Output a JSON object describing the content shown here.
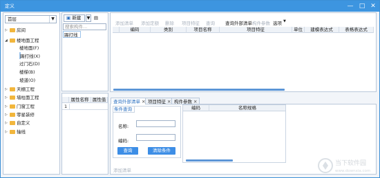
{
  "window": {
    "title": "定义"
  },
  "left": {
    "floor_select": "首层",
    "tree": [
      {
        "label": "房间",
        "level": 0,
        "expanded": false
      },
      {
        "label": "楼地面工程",
        "level": 0,
        "expanded": true
      },
      {
        "label": "楼地面(F)",
        "level": 1
      },
      {
        "label": "踢打线(X)",
        "level": 1,
        "selected": true
      },
      {
        "label": "过门石(D)",
        "level": 1
      },
      {
        "label": "楼梯(B)",
        "level": 1
      },
      {
        "label": "坡道(O)",
        "level": 1
      },
      {
        "label": "天棚工程",
        "level": 0,
        "expanded": false
      },
      {
        "label": "墙柱面工程",
        "level": 0,
        "expanded": false
      },
      {
        "label": "门窗工程",
        "level": 0,
        "expanded": false
      },
      {
        "label": "零星装修",
        "level": 0,
        "expanded": false
      },
      {
        "label": "自定义",
        "level": 0,
        "expanded": false
      },
      {
        "label": "轴线",
        "level": 0,
        "expanded": false
      }
    ]
  },
  "middle": {
    "new_label": "新建",
    "search_placeholder": "搜索构件...",
    "component_item": "踢打线",
    "props_headers": [
      "属性名称",
      "属性值"
    ],
    "props_row_num": "1"
  },
  "toolbar": {
    "items": [
      {
        "label": "添加清单",
        "enabled": false
      },
      {
        "label": "添加定额",
        "enabled": false
      },
      {
        "label": "删除",
        "enabled": false
      },
      {
        "label": "项目特征",
        "enabled": false
      },
      {
        "label": "查询",
        "enabled": false
      },
      {
        "label": "查询外部清单",
        "enabled": true
      },
      {
        "label": "构件参数",
        "enabled": false
      },
      {
        "label": "选项",
        "enabled": true
      }
    ]
  },
  "table": {
    "headers": [
      "编码",
      "类别",
      "项目名称",
      "项目特征",
      "单位",
      "建模表达式",
      "表格表达式"
    ]
  },
  "bottom": {
    "tabs": [
      {
        "label": "查询外部清单",
        "active": true
      },
      {
        "label": "项目特征",
        "active": false
      },
      {
        "label": "构件参数",
        "active": false
      }
    ],
    "query_group": "条件查询",
    "name_label": "名称:",
    "code_label": "编码:",
    "search_button": "查询",
    "clear_button": "清除条件",
    "result_headers": [
      "编码",
      "名称规格"
    ],
    "add_list_button": "添加清单"
  },
  "watermark": {
    "line1": "当下软件园",
    "line2": "www.downxia.com"
  },
  "colors": {
    "titlebar": "#3d95e0",
    "accent": "#3d8ee6",
    "folder": "#f2b63c"
  }
}
